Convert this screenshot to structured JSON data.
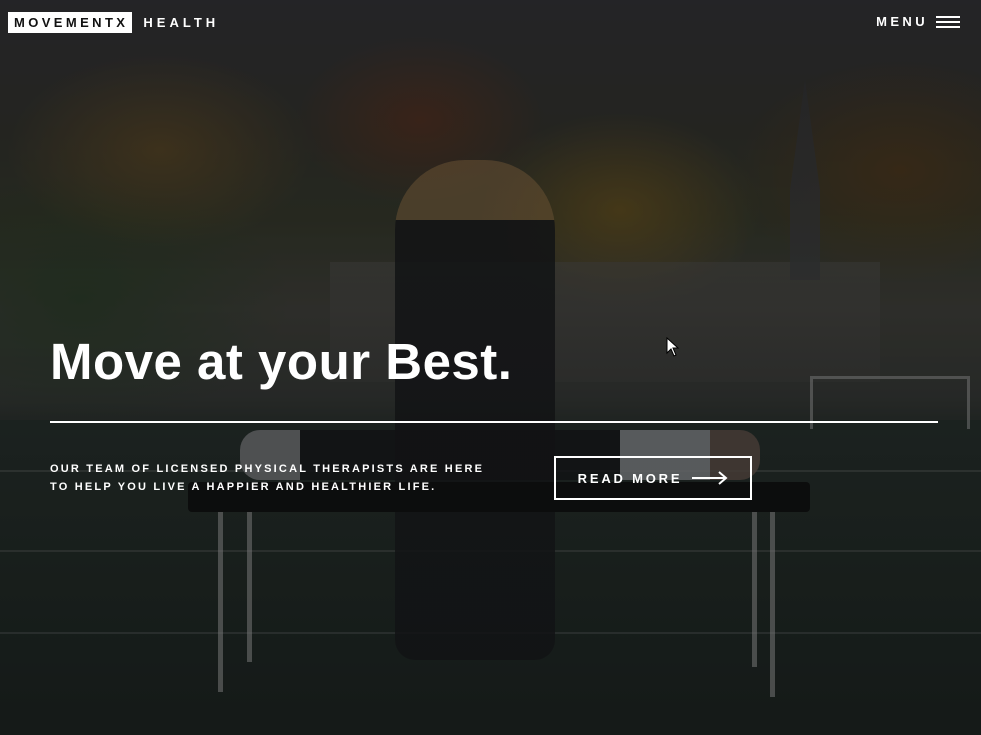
{
  "header": {
    "logo_box": "MOVEMENTX",
    "logo_suffix": "HEALTH",
    "menu_label": "MENU"
  },
  "hero": {
    "headline": "Move at your Best.",
    "tagline_line1": "OUR TEAM OF LICENSED PHYSICAL THERAPISTS ARE HERE",
    "tagline_line2": "TO HELP YOU LIVE A HAPPIER AND HEALTHIER LIFE.",
    "cta_label": "READ MORE"
  },
  "colors": {
    "text": "#ffffff",
    "overlay": "rgba(0,0,0,0.38)"
  },
  "icons": {
    "menu": "hamburger-icon",
    "cta": "arrow-right-icon",
    "cursor": "mouse-pointer-icon"
  }
}
